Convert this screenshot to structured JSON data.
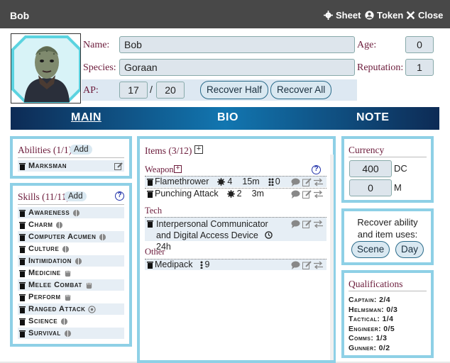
{
  "window": {
    "title": "Bob",
    "sheet_label": "Sheet",
    "token_label": "Token",
    "close_label": "Close"
  },
  "character": {
    "name_label": "Name:",
    "name": "Bob",
    "species_label": "Species:",
    "species": "Goraan",
    "ap_label": "AP:",
    "ap_current": "17",
    "ap_sep": "/",
    "ap_max": "20",
    "recover_half": "Recover Half",
    "recover_all": "Recover All",
    "age_label": "Age:",
    "age": "0",
    "reputation_label": "Reputation:",
    "reputation": "1"
  },
  "tabs": [
    "MAIN",
    "BIO",
    "NOTE"
  ],
  "abilities": {
    "title": "Abilities (1/1)",
    "add": "Add",
    "items": [
      "Marksman"
    ]
  },
  "skills": {
    "title": "Skills (11/11)",
    "add": "Add",
    "help": "?",
    "items": [
      "Awareness",
      "Charm",
      "Computer Acumen",
      "Culture",
      "Intimidation",
      "Medicine",
      "Melee Combat",
      "Perform",
      "Ranged Attack",
      "Science",
      "Survival"
    ],
    "dice_icons": [
      "d6-half",
      "d6-half",
      "d6-half",
      "d6-half",
      "d6-half",
      "d6-fist",
      "d6-fist",
      "d6-fist",
      "target",
      "d6-half",
      "d6-half"
    ]
  },
  "items": {
    "title": "Items (3/12)",
    "help": "?",
    "weapon_label": "Weapon",
    "weapons": [
      {
        "name": "Flamethrower",
        "dmg": "4",
        "range": "15m",
        "ammo": "0"
      },
      {
        "name": "Punching Attack",
        "dmg": "2",
        "range": "3m"
      }
    ],
    "tech_label": "Tech",
    "tech": [
      {
        "name": "Interpersonal Communicator and Digital Access Device",
        "time": "24h"
      }
    ],
    "other_label": "Other",
    "other": [
      {
        "name": "Medipack",
        "qty": "9"
      }
    ]
  },
  "currency": {
    "title": "Currency",
    "dc_value": "400",
    "dc_label": "DC",
    "m_value": "0",
    "m_label": "M"
  },
  "recover": {
    "text1": "Recover ability",
    "text2": "and item uses:",
    "scene": "Scene",
    "day": "Day"
  },
  "qualifications": {
    "title": "Qualifications",
    "items": [
      "Captain: 2/4",
      "Helmsman: 0/3",
      "Tactical: 1/4",
      "Engineer: 0/5",
      "Comms: 1/3",
      "Gunner: 0/2"
    ]
  },
  "colors": {
    "accent_border": "#8ed0e6",
    "label": "#6b1a3a",
    "tab_gradient_mid": "#1276b0"
  }
}
